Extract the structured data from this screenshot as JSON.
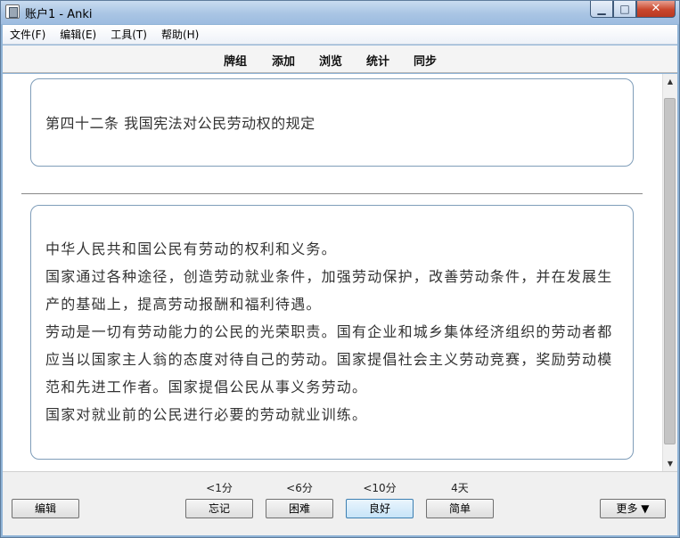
{
  "window": {
    "title": "账户1 - Anki"
  },
  "titlebar": {
    "minimize_glyph": "▁",
    "maximize_glyph": "□",
    "close_glyph": "✕"
  },
  "menu": {
    "items": [
      "文件(F)",
      "编辑(E)",
      "工具(T)",
      "帮助(H)"
    ]
  },
  "toolbar": {
    "links": [
      "牌组",
      "添加",
      "浏览",
      "统计",
      "同步"
    ]
  },
  "card": {
    "question": "第四十二条 我国宪法对公民劳动权的规定",
    "answer_lines": [
      "中华人民共和国公民有劳动的权利和义务。",
      "国家通过各种途径，创造劳动就业条件，加强劳动保护，改善劳动条件，并在发展生产的基础上，提高劳动报酬和福利待遇。",
      "劳动是一切有劳动能力的公民的光荣职责。国有企业和城乡集体经济组织的劳动者都应当以国家主人翁的态度对待自己的劳动。国家提倡社会主义劳动竞赛，奖励劳动模范和先进工作者。国家提倡公民从事义务劳动。",
      "国家对就业前的公民进行必要的劳动就业训练。"
    ]
  },
  "bottom": {
    "edit_label": "编辑",
    "more_label": "更多 ▼",
    "answers": [
      {
        "interval": "<1分",
        "label": "忘记"
      },
      {
        "interval": "<6分",
        "label": "困难"
      },
      {
        "interval": "<10分",
        "label": "良好"
      },
      {
        "interval": "4天",
        "label": "简单"
      }
    ]
  },
  "scrollbar": {
    "up_glyph": "▲",
    "down_glyph": "▼"
  }
}
